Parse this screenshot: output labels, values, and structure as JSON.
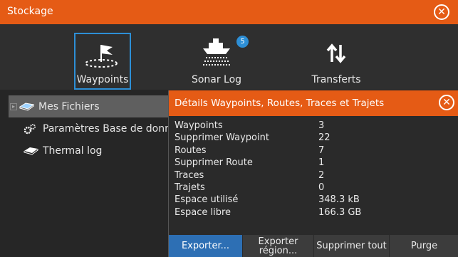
{
  "window": {
    "title": "Stockage"
  },
  "toolbar": {
    "items": [
      {
        "label": "Waypoints",
        "icon": "waypoint-flag-icon",
        "selected": true
      },
      {
        "label": "Sonar Log",
        "icon": "boat-sonar-icon",
        "badge": "5"
      },
      {
        "label": "Transferts",
        "icon": "transfer-arrows-icon"
      }
    ]
  },
  "tree": {
    "items": [
      {
        "label": "Mes Fichiers",
        "icon": "storage-card-icon",
        "selected": true
      },
      {
        "label": "Paramètres Base de données",
        "icon": "settings-gears-icon"
      },
      {
        "label": "Thermal log",
        "icon": "storage-card-icon"
      }
    ]
  },
  "dialog": {
    "title": "Détails Waypoints, Routes, Traces et Trajets",
    "rows": [
      {
        "key": "Waypoints",
        "value": "3"
      },
      {
        "key": "Supprimer Waypoint",
        "value": "22"
      },
      {
        "key": "Routes",
        "value": "7"
      },
      {
        "key": "Supprimer Route",
        "value": "1"
      },
      {
        "key": "Traces",
        "value": "2"
      },
      {
        "key": "Trajets",
        "value": "0"
      },
      {
        "key": "Espace utilisé",
        "value": "348.3 kB"
      },
      {
        "key": "Espace libre",
        "value": "166.3 GB"
      }
    ],
    "buttons": {
      "export": "Exporter...",
      "export_region": "Exporter région...",
      "delete_all": "Supprimer tout",
      "purge": "Purge"
    }
  },
  "colors": {
    "accent": "#e55b15",
    "selection": "#2d8fd6",
    "primary_button": "#2d6fb4"
  }
}
